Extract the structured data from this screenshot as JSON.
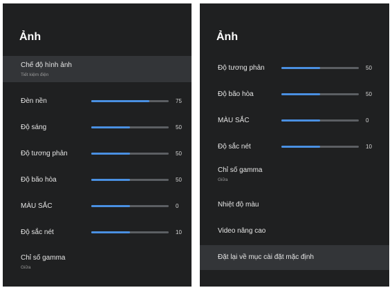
{
  "left_panel": {
    "title": "Ảnh",
    "selected_item": {
      "label": "Chế độ hình ảnh",
      "sub": "Tiết kiệm điện"
    },
    "sliders": [
      {
        "label": "Đèn nền",
        "value": "75",
        "fraction": 0.75
      },
      {
        "label": "Độ sáng",
        "value": "50",
        "fraction": 0.5
      },
      {
        "label": "Độ tương phản",
        "value": "50",
        "fraction": 0.5
      },
      {
        "label": "Độ bão hòa",
        "value": "50",
        "fraction": 0.5
      },
      {
        "label": "MÀU SẮC",
        "value": "0",
        "fraction": 0.5
      },
      {
        "label": "Độ sắc nét",
        "value": "10",
        "fraction": 0.5
      }
    ],
    "gamma": {
      "label": "Chỉ số gamma",
      "sub": "Giữa"
    }
  },
  "right_panel": {
    "title": "Ảnh",
    "sliders": [
      {
        "label": "Độ tương phản",
        "value": "50",
        "fraction": 0.5
      },
      {
        "label": "Độ bão hòa",
        "value": "50",
        "fraction": 0.5
      },
      {
        "label": "MÀU SẮC",
        "value": "0",
        "fraction": 0.5
      },
      {
        "label": "Độ sắc nét",
        "value": "10",
        "fraction": 0.5
      }
    ],
    "gamma": {
      "label": "Chỉ số gamma",
      "sub": "Giữa"
    },
    "items": [
      {
        "label": "Nhiệt độ màu"
      },
      {
        "label": "Video nâng cao"
      }
    ],
    "reset": {
      "label": "Đặt lại về mục cài đặt mặc định"
    }
  },
  "colors": {
    "panel_bg": "#1f2021",
    "selected_bg": "#333538",
    "slider_fill": "#4a90e2",
    "slider_track": "#5c5f63"
  }
}
